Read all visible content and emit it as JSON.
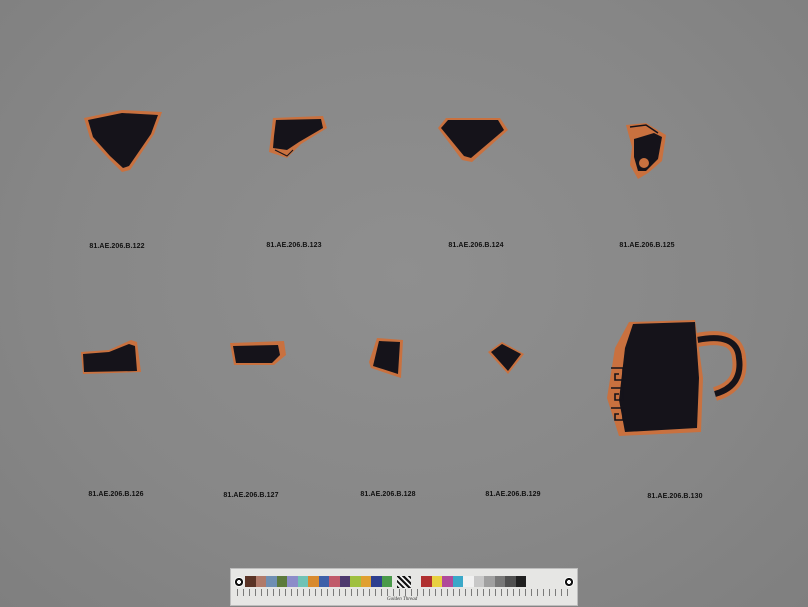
{
  "specimens": [
    {
      "id": "frag-122",
      "label": "81.AE.206.B.122"
    },
    {
      "id": "frag-123",
      "label": "81.AE.206.B.123"
    },
    {
      "id": "frag-124",
      "label": "81.AE.206.B.124"
    },
    {
      "id": "frag-125",
      "label": "81.AE.206.B.125"
    },
    {
      "id": "frag-126",
      "label": "81.AE.206.B.126"
    },
    {
      "id": "frag-127",
      "label": "81.AE.206.B.127"
    },
    {
      "id": "frag-128",
      "label": "81.AE.206.B.128"
    },
    {
      "id": "frag-129",
      "label": "81.AE.206.B.129"
    },
    {
      "id": "frag-130",
      "label": "81.AE.206.B.130"
    }
  ],
  "colors": {
    "background": "#8a8a8a",
    "glaze": "#15131a",
    "clay": "#c9713f",
    "label_text": "#111111"
  },
  "color_card": {
    "patch_colors": [
      "#5a3326",
      "#b07a6a",
      "#6f8fb3",
      "#5c7a3c",
      "#8c8cc9",
      "#6fc2b5",
      "#d88a2e",
      "#3d5fa8",
      "#c05a6a",
      "#4e3a6e",
      "#9fc040",
      "#e0a030",
      "#2e3f8f",
      "#4a9a4a",
      "#b03030",
      "#e8d040",
      "#b04a9a",
      "#3aa8c8",
      "#f0f0f0",
      "#c8c8c8",
      "#a0a0a0",
      "#787878",
      "#505050",
      "#202020"
    ],
    "brand": "Golden Thread"
  }
}
